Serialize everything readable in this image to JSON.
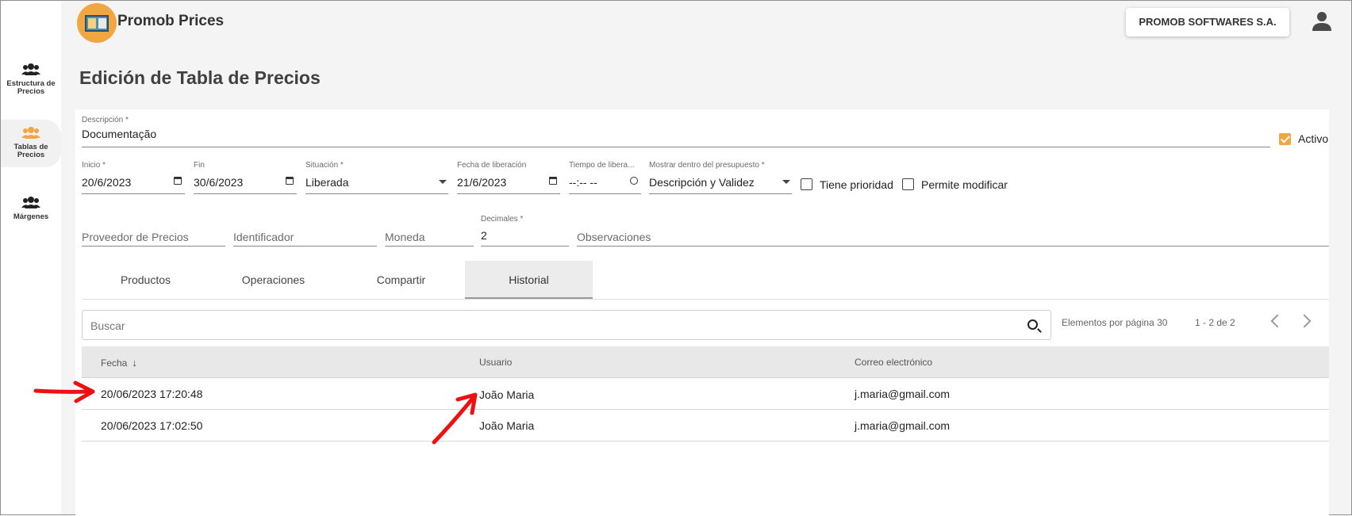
{
  "app": {
    "title": "Promob Prices",
    "company": "PROMOB SOFTWARES S.A."
  },
  "rail": [
    {
      "label_1": "Estructura de",
      "label_2": "Precios",
      "icon": "people-icon"
    },
    {
      "label_1": "Tablas de",
      "label_2": "Precios",
      "icon": "people-icon-active"
    },
    {
      "label_1": "Márgenes",
      "label_2": "",
      "icon": "people-icon"
    }
  ],
  "page": {
    "title": "Edición de Tabla de Precios"
  },
  "form": {
    "descripcion": {
      "label": "Descripción *",
      "value": "Documentação"
    },
    "activo": {
      "label": "Activo",
      "checked": true
    },
    "inicio": {
      "label": "Inicio *",
      "value": "20/6/2023"
    },
    "fin": {
      "label": "Fin",
      "value": "30/6/2023"
    },
    "situacion": {
      "label": "Situación *",
      "value": "Liberada"
    },
    "fecha_liberacion": {
      "label": "Fecha de liberación",
      "value": "21/6/2023"
    },
    "tiempo_liberacion": {
      "label": "Tiempo de libera...",
      "value": "--:-- --"
    },
    "mostrar": {
      "label": "Mostrar dentro del presupuesto *",
      "value": "Descripción y Validez"
    },
    "tiene_prioridad": {
      "label": "Tiene prioridad",
      "checked": false
    },
    "permite_modificar": {
      "label": "Permite modificar",
      "checked": false
    },
    "proveedor": {
      "placeholder": "Proveedor de Precios"
    },
    "identificador": {
      "placeholder": "Identificador"
    },
    "moneda": {
      "placeholder": "Moneda"
    },
    "decimales": {
      "label": "Decimales *",
      "value": "2"
    },
    "observaciones": {
      "placeholder": "Observaciones"
    }
  },
  "tabs": [
    {
      "label": "Productos",
      "active": false
    },
    {
      "label": "Operaciones",
      "active": false
    },
    {
      "label": "Compartir",
      "active": false
    },
    {
      "label": "Historial",
      "active": true
    }
  ],
  "search": {
    "placeholder": "Buscar"
  },
  "paginator": {
    "per_page_label": "Elementos por página 30",
    "range": "1 - 2 de 2"
  },
  "table": {
    "headers": [
      "Fecha",
      "Usuario",
      "Correo electrónico"
    ],
    "rows": [
      {
        "fecha": "20/06/2023 17:20:48",
        "usuario": "João Maria",
        "correo": "j.maria@gmail.com"
      },
      {
        "fecha": "20/06/2023 17:02:50",
        "usuario": "João Maria",
        "correo": "j.maria@gmail.com"
      }
    ]
  },
  "colors": {
    "accent": "#f0a742",
    "annotation": "#ee1111"
  }
}
